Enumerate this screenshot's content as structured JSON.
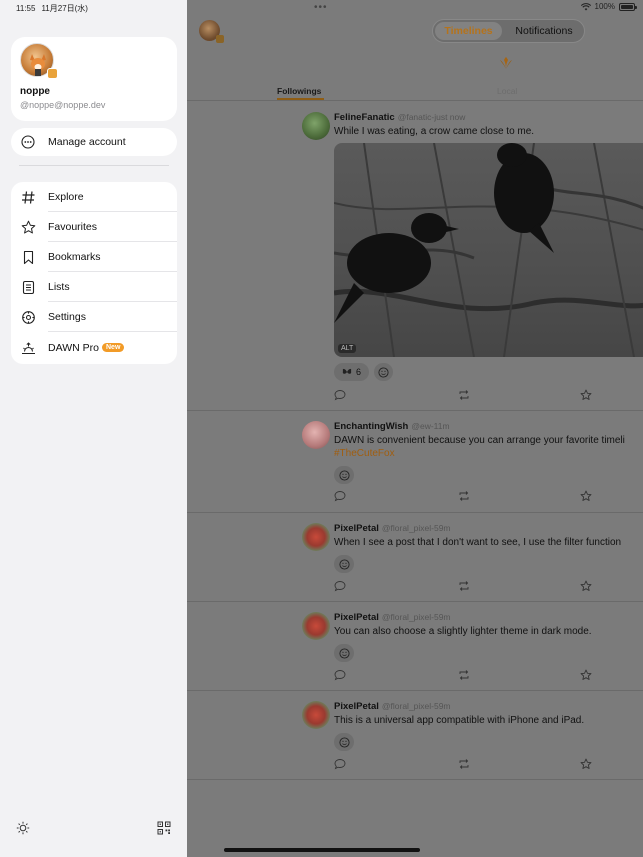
{
  "status_bar": {
    "time": "11:55",
    "date": "11月27日(水)",
    "battery": "100%",
    "battery_level": 1.0
  },
  "sidebar": {
    "profile": {
      "name": "noppe",
      "handle": "@noppe@noppe.dev"
    },
    "manage_account": "Manage account",
    "menu": [
      {
        "label": "Explore",
        "icon": "hashtag-icon"
      },
      {
        "label": "Favourites",
        "icon": "star-icon"
      },
      {
        "label": "Bookmarks",
        "icon": "bookmark-icon"
      },
      {
        "label": "Lists",
        "icon": "list-icon"
      },
      {
        "label": "Settings",
        "icon": "gear-icon"
      },
      {
        "label": "DAWN Pro",
        "icon": "sunrise-icon",
        "badge": "New"
      }
    ],
    "bottom": {
      "left_icon": "brightness-icon",
      "right_icon": "qr-code-icon"
    }
  },
  "main": {
    "segments": {
      "active": "Timelines",
      "inactive": "Notifications"
    },
    "tabs": {
      "active": "Followings",
      "inactive": "Local"
    },
    "posts": [
      {
        "name": "FelineFanatic",
        "handle": "@fanatic-just now",
        "text": "While I was eating, a crow came close to me.",
        "image_alt": "ALT",
        "reaction_count": "6"
      },
      {
        "name": "EnchantingWish",
        "handle": "@ew-11m",
        "text": "DAWN is convenient because you can arrange your favorite timeli",
        "hashtag": "#TheCuteFox"
      },
      {
        "name": "PixelPetal",
        "handle": "@floral_pixel-59m",
        "text": "When I see a post that I don't want to see, I use the filter function"
      },
      {
        "name": "PixelPetal",
        "handle": "@floral_pixel-59m",
        "text": "You can also choose a slightly lighter theme in dark mode."
      },
      {
        "name": "PixelPetal",
        "handle": "@floral_pixel-59m",
        "text": "This is a universal app compatible with iPhone and iPad."
      }
    ]
  },
  "colors": {
    "accent": "#f29b27",
    "sidebar_bg": "#f2f2f4",
    "dim_bg": "#7b7b7b"
  }
}
